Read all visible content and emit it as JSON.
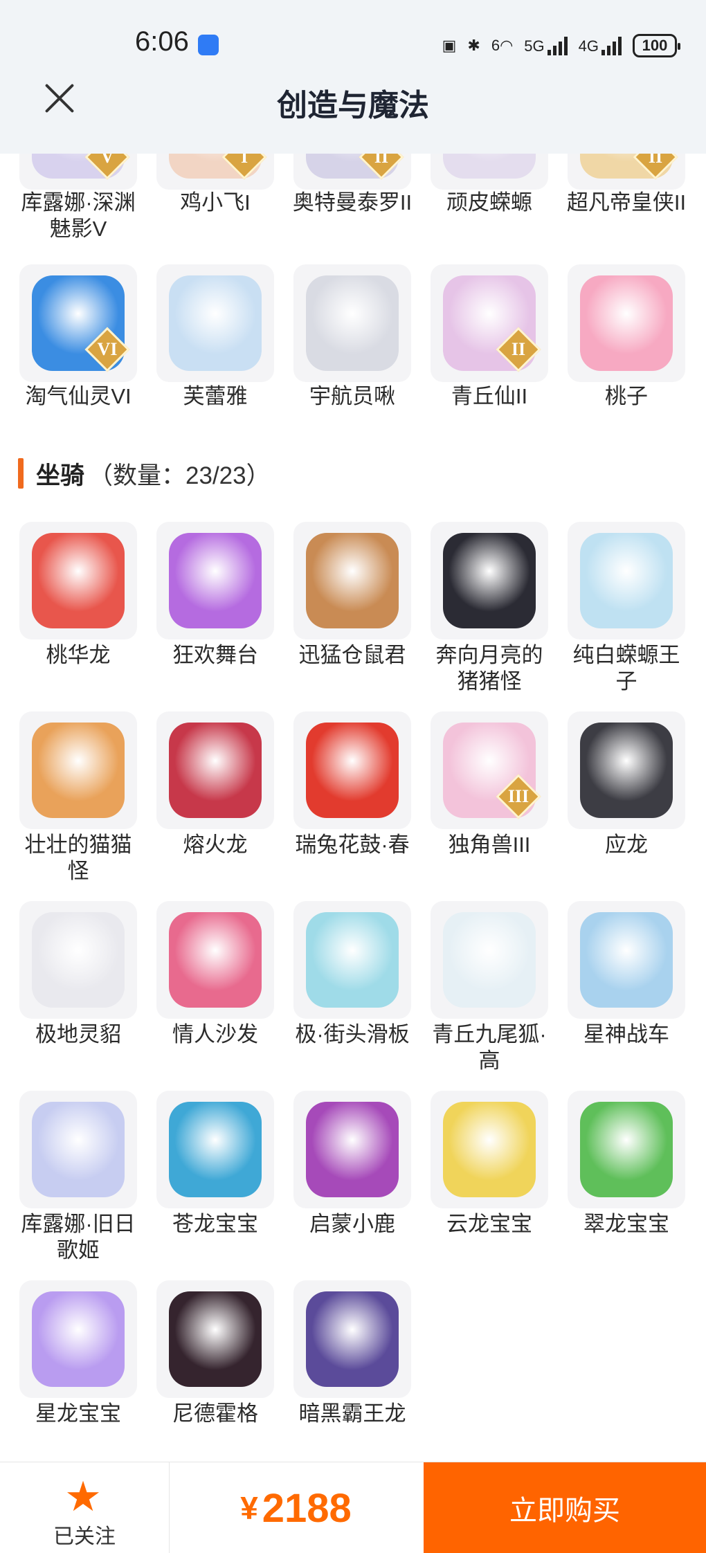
{
  "status_bar": {
    "time": "6:06",
    "network_labels": [
      "6",
      "5G",
      "4G"
    ],
    "battery": "100"
  },
  "header": {
    "title": "创造与魔法"
  },
  "top_partial_row": [
    {
      "name": "库露娜·深渊魅影V",
      "badge": "V",
      "color": "#d8d2ee"
    },
    {
      "name": "鸡小飞I",
      "badge": "I",
      "color": "#f2d5c4"
    },
    {
      "name": "奥特曼泰罗II",
      "badge": "II",
      "color": "#d6d3e8"
    },
    {
      "name": "顽皮蝾螈",
      "badge": "",
      "color": "#e4ddee"
    },
    {
      "name": "超凡帝皇侠II",
      "badge": "II",
      "color": "#f0d7a6"
    }
  ],
  "partner_row": [
    {
      "name": "淘气仙灵VI",
      "badge": "VI",
      "color": "#3b8de2"
    },
    {
      "name": "芙蕾雅",
      "badge": "",
      "color": "#c9dff3"
    },
    {
      "name": "宇航员啾",
      "badge": "",
      "color": "#d9dbe3"
    },
    {
      "name": "青丘仙II",
      "badge": "II",
      "color": "#e6c4e7"
    },
    {
      "name": "桃子",
      "badge": "",
      "color": "#f7a9c2"
    }
  ],
  "mounts_section": {
    "title": "坐骑",
    "count": "（数量：23/23）",
    "items": [
      {
        "name": "桃华龙",
        "badge": "",
        "color": "#e8564c"
      },
      {
        "name": "狂欢舞台",
        "badge": "",
        "color": "#b56be0"
      },
      {
        "name": "迅猛仓鼠君",
        "badge": "",
        "color": "#c98b54"
      },
      {
        "name": "奔向月亮的猪猪怪",
        "badge": "",
        "color": "#2b2b34"
      },
      {
        "name": "纯白蝾螈王子",
        "badge": "",
        "color": "#bfe1f2"
      },
      {
        "name": "壮壮的猫猫怪",
        "badge": "",
        "color": "#e9a25a"
      },
      {
        "name": "熔火龙",
        "badge": "",
        "color": "#c7384a"
      },
      {
        "name": "瑞兔花鼓·春",
        "badge": "",
        "color": "#e23b2e"
      },
      {
        "name": "独角兽III",
        "badge": "III",
        "color": "#f3c3da"
      },
      {
        "name": "应龙",
        "badge": "",
        "color": "#3d3d44"
      },
      {
        "name": "极地灵貂",
        "badge": "",
        "color": "#e9e9ee"
      },
      {
        "name": "情人沙发",
        "badge": "",
        "color": "#e86a8e"
      },
      {
        "name": "极·街头滑板",
        "badge": "",
        "color": "#9fdbe8"
      },
      {
        "name": "青丘九尾狐·高",
        "badge": "",
        "color": "#e6f0f5"
      },
      {
        "name": "星神战车",
        "badge": "",
        "color": "#a9d2ee"
      },
      {
        "name": "库露娜·旧日歌姬",
        "badge": "",
        "color": "#c7cdf1"
      },
      {
        "name": "苍龙宝宝",
        "badge": "",
        "color": "#3fa8d6"
      },
      {
        "name": "启蒙小鹿",
        "badge": "",
        "color": "#a64ab9"
      },
      {
        "name": "云龙宝宝",
        "badge": "",
        "color": "#f0d45a"
      },
      {
        "name": "翠龙宝宝",
        "badge": "",
        "color": "#5fbf5a"
      },
      {
        "name": "星龙宝宝",
        "badge": "",
        "color": "#b99cf0"
      },
      {
        "name": "尼德霍格",
        "badge": "",
        "color": "#35242e"
      },
      {
        "name": "暗黑霸王龙",
        "badge": "",
        "color": "#5b4b9a"
      }
    ]
  },
  "bottom_bar": {
    "follow_label": "已关注",
    "follow_icon": "star-icon",
    "currency": "¥",
    "price": "2188",
    "buy_label": "立即购买"
  },
  "colors": {
    "accent": "#ff6400",
    "header_bg": "#f1f4f7"
  }
}
